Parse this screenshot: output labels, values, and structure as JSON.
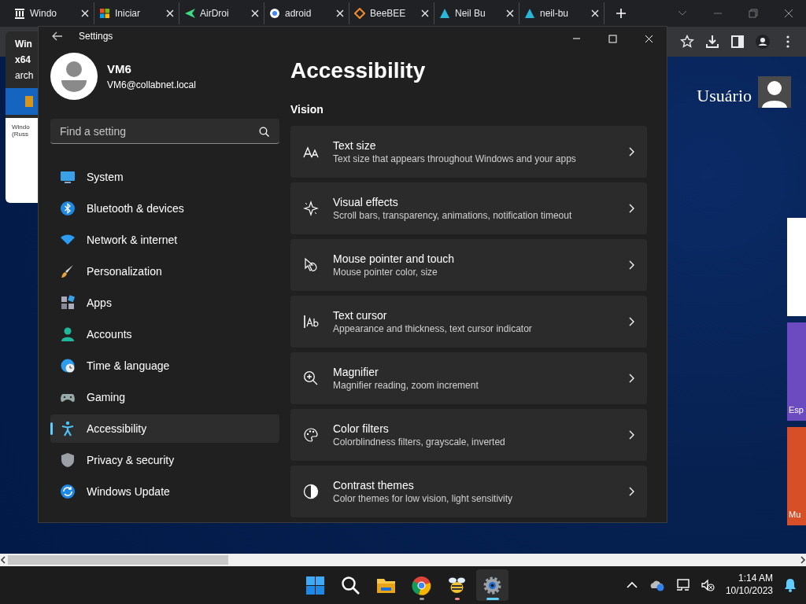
{
  "browser_tabs": [
    {
      "title": "Windo",
      "kind": "columns"
    },
    {
      "title": "Iniciar",
      "kind": "grid"
    },
    {
      "title": "AirDroi",
      "kind": "arrow"
    },
    {
      "title": "adroid",
      "kind": "ring"
    },
    {
      "title": "BeeBEE",
      "kind": "diamond"
    },
    {
      "title": "Neil Bu",
      "kind": "triangle"
    },
    {
      "title": "neil-bu",
      "kind": "triangle"
    }
  ],
  "tab_preview": {
    "lines": [
      "Win",
      "x64",
      "arch"
    ],
    "doc_title": "Windo",
    "doc_subtitle": "(Russ"
  },
  "web_page": {
    "user_label": "Usuário",
    "tiles": [
      {
        "color": "#ffffff"
      },
      {
        "color": "#6b4bbf",
        "label": "Esp"
      },
      {
        "color": "#d64f27",
        "label": "Mu"
      }
    ]
  },
  "settings": {
    "title": "Settings",
    "user": {
      "name": "VM6",
      "email": "VM6@collabnet.local"
    },
    "search": {
      "placeholder": "Find a setting"
    },
    "nav": [
      {
        "label": "System",
        "kind": "system",
        "selected": false
      },
      {
        "label": "Bluetooth & devices",
        "kind": "bluetooth",
        "selected": false
      },
      {
        "label": "Network & internet",
        "kind": "network",
        "selected": false
      },
      {
        "label": "Personalization",
        "kind": "personalization",
        "selected": false
      },
      {
        "label": "Apps",
        "kind": "apps",
        "selected": false
      },
      {
        "label": "Accounts",
        "kind": "accounts",
        "selected": false
      },
      {
        "label": "Time & language",
        "kind": "time",
        "selected": false
      },
      {
        "label": "Gaming",
        "kind": "gaming",
        "selected": false
      },
      {
        "label": "Accessibility",
        "kind": "accessibility",
        "selected": true
      },
      {
        "label": "Privacy & security",
        "kind": "privacy",
        "selected": false
      },
      {
        "label": "Windows Update",
        "kind": "update",
        "selected": false
      }
    ],
    "page_title": "Accessibility",
    "section": "Vision",
    "items": [
      {
        "title": "Text size",
        "description": "Text size that appears throughout Windows and your apps",
        "kind": "textsize"
      },
      {
        "title": "Visual effects",
        "description": "Scroll bars, transparency, animations, notification timeout",
        "kind": "effects"
      },
      {
        "title": "Mouse pointer and touch",
        "description": "Mouse pointer color, size",
        "kind": "pointer"
      },
      {
        "title": "Text cursor",
        "description": "Appearance and thickness, text cursor indicator",
        "kind": "cursor"
      },
      {
        "title": "Magnifier",
        "description": "Magnifier reading, zoom increment",
        "kind": "magnifier"
      },
      {
        "title": "Color filters",
        "description": "Colorblindness filters, grayscale, inverted",
        "kind": "filters"
      },
      {
        "title": "Contrast themes",
        "description": "Color themes for low vision, light sensitivity",
        "kind": "contrast"
      }
    ]
  },
  "taskbar": {
    "apps": [
      {
        "kind": "start",
        "running": false,
        "selected": false
      },
      {
        "kind": "search",
        "running": false,
        "selected": false
      },
      {
        "kind": "folder",
        "running": false,
        "selected": false
      },
      {
        "kind": "browser",
        "running": true,
        "selected": false
      },
      {
        "kind": "bee",
        "running": true,
        "selected": false
      },
      {
        "kind": "gear",
        "running": true,
        "selected": true
      }
    ],
    "time": "1:14 AM",
    "date": "10/10/2023"
  }
}
